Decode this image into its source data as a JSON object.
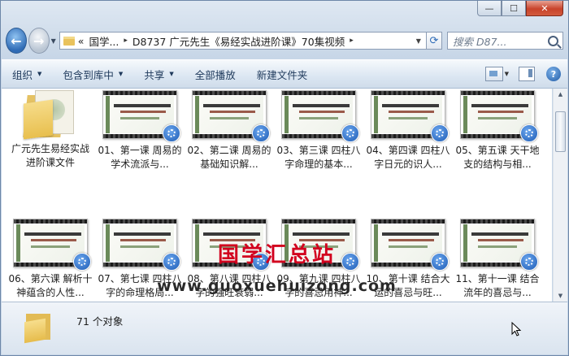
{
  "window": {
    "caption_buttons": {
      "minimize": "—",
      "maximize": "☐",
      "close": "✕"
    },
    "nav": {
      "back_glyph": "←",
      "forward_glyph": "→"
    },
    "address": {
      "overflow": "«",
      "crumbs": [
        "国学...",
        "D8737 广元先生《易经实战进阶课》70集视频"
      ],
      "separator": "▸"
    },
    "search": {
      "placeholder": "搜索 D87..."
    }
  },
  "toolbar": {
    "organize": "组织",
    "include_in_library": "包含到库中",
    "share": "共享",
    "play_all": "全部播放",
    "new_folder": "新建文件夹",
    "help_glyph": "?"
  },
  "items": [
    {
      "type": "folder",
      "label": "广元先生易经实战进阶课文件"
    },
    {
      "type": "video",
      "label": "01、第一课 周易的学术流派与..."
    },
    {
      "type": "video",
      "label": "02、第二课 周易的基础知识解..."
    },
    {
      "type": "video",
      "label": "03、第三课 四柱八字命理的基本..."
    },
    {
      "type": "video",
      "label": "04、第四课 四柱八字日元的识人..."
    },
    {
      "type": "video",
      "label": "05、第五课 天干地支的结构与相..."
    },
    {
      "type": "video",
      "label": "06、第六课 解析十神蕴含的人性..."
    },
    {
      "type": "video",
      "label": "07、第七课 四柱八字的命理格局..."
    },
    {
      "type": "video",
      "label": "08、第八课 四柱八字的强旺衰弱..."
    },
    {
      "type": "video",
      "label": "09、第九课 四柱八字的喜忌用神..."
    },
    {
      "type": "video",
      "label": "10、第十课 结合大运的喜忌与旺..."
    },
    {
      "type": "video",
      "label": "11、第十一课 结合流年的喜忌与..."
    }
  ],
  "watermark": {
    "title": "国学汇总站",
    "url": "www.guoxuehuizong.com"
  },
  "status": {
    "count_text": "71 个对象"
  },
  "colors": {
    "accent": "#2f6bb5",
    "watermark_red": "#d2001e",
    "close_red": "#c8432b"
  }
}
